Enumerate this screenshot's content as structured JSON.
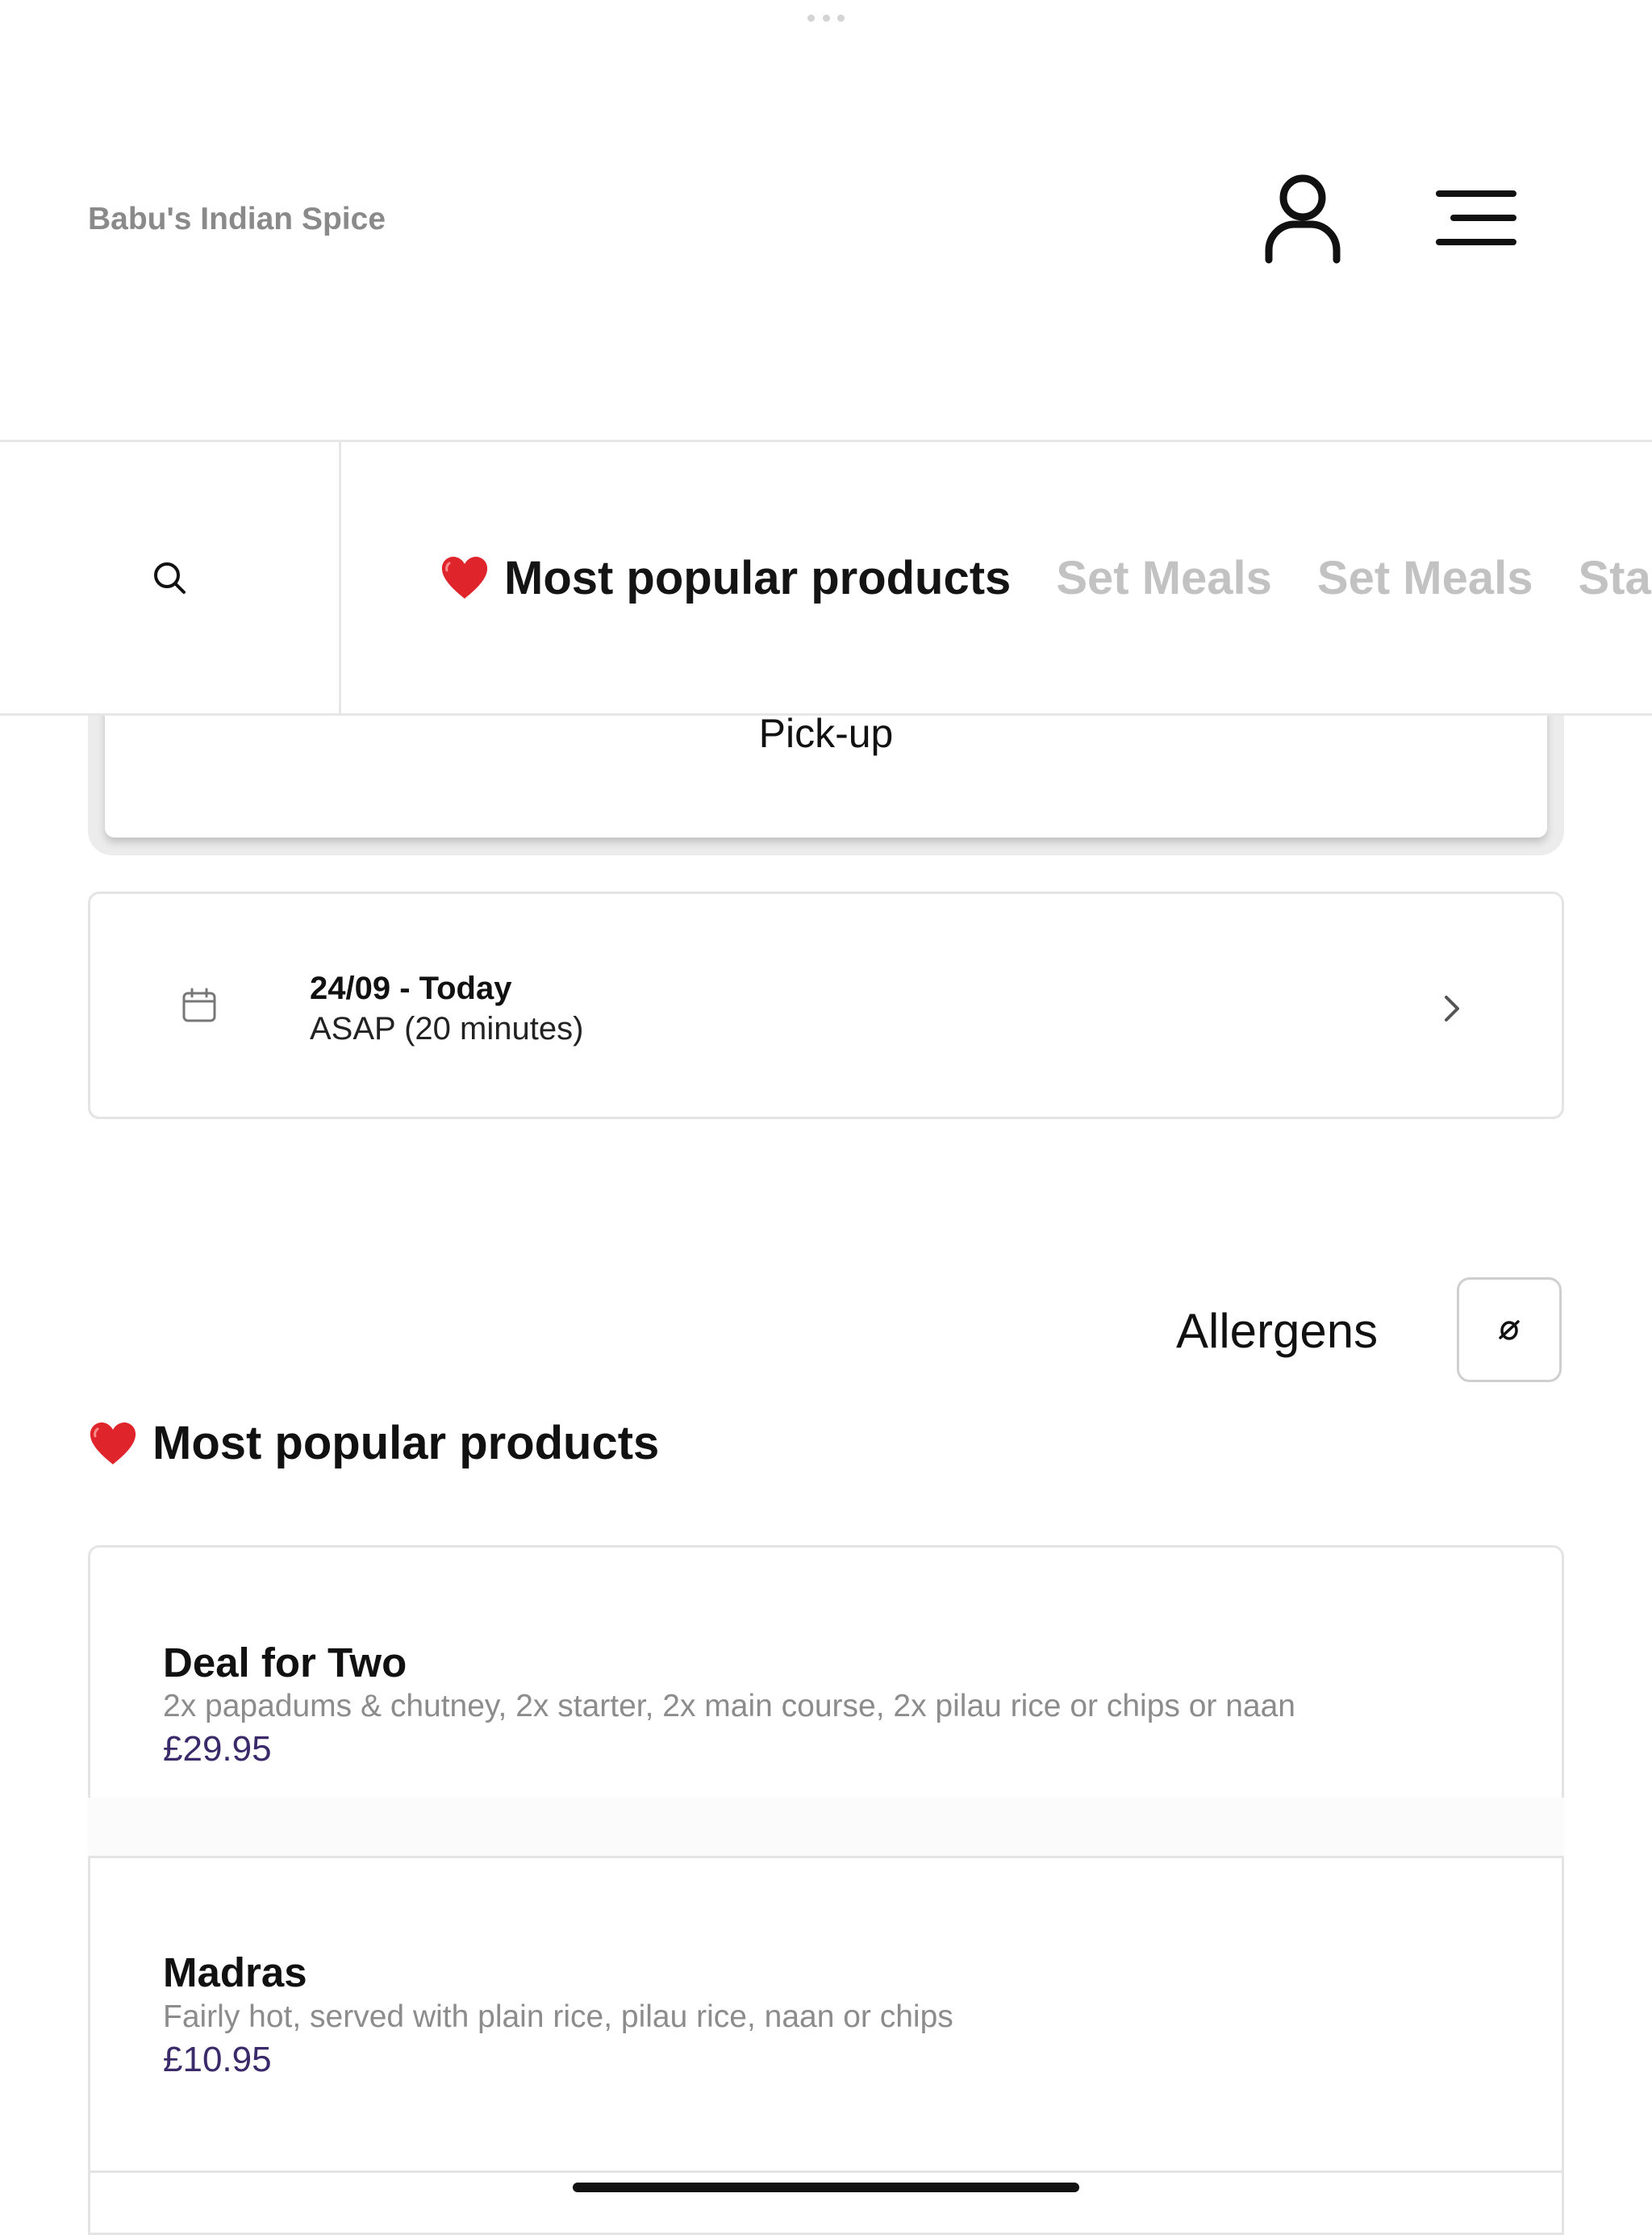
{
  "header": {
    "brand": "Babu's Indian Spice"
  },
  "nav": {
    "tabs": [
      {
        "label": "Most popular products",
        "active": true
      },
      {
        "label": "Set Meals",
        "active": false
      },
      {
        "label": "Set Meals",
        "active": false
      },
      {
        "label": "Sta",
        "active": false
      }
    ]
  },
  "order_mode": {
    "label": "Pick-up"
  },
  "schedule": {
    "date_label": "24/09 - Today",
    "time_label": "ASAP (20 minutes)"
  },
  "allergens": {
    "label": "Allergens"
  },
  "section": {
    "title": "Most popular products"
  },
  "products": [
    {
      "name": "Deal for Two",
      "description": "2x papadums & chutney, 2x starter, 2x main course, 2x pilau rice or chips or naan",
      "price": "£29.95"
    },
    {
      "name": "Madras",
      "description": "Fairly hot, served with plain rice, pilau rice, naan or chips",
      "price": "£10.95"
    }
  ],
  "colors": {
    "price": "#3b2a6a",
    "inactive_tab": "#c2c2c2",
    "heart": "#e0242b"
  },
  "icons": {
    "account": "user-icon",
    "menu": "hamburger-menu-icon",
    "search": "search-icon",
    "calendar": "calendar-icon",
    "chevron": "chevron-right-icon",
    "allergens": "allergen-filter-icon",
    "heart": "heart-icon"
  }
}
